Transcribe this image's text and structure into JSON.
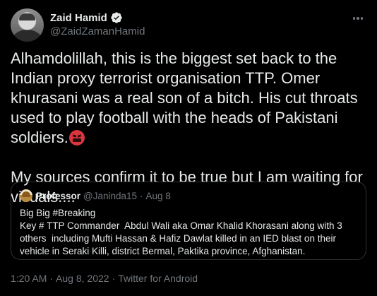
{
  "author": {
    "display_name": "Zaid Hamid",
    "handle": "@ZaidZamanHamid",
    "verified": true,
    "avatar_icon": "avatar-photo"
  },
  "tweet": {
    "line1": "Alhamdolillah, this is the biggest set back to the Indian proxy terrorist organisation TTP. Omer khurasani was a real son of a bitch. His cut throats used to play football with the heads of Pakistani soldiers.",
    "emoji": "enraged-face-with-symbols-on-mouth",
    "line2": "My sources confirm it to be true but I am waiting for visuals...."
  },
  "quote": {
    "name": "Professor",
    "handle": "@Janinda15",
    "dot": "·",
    "date": "Aug 8",
    "text": "Big Big #Breaking\nKey # TTP Commander  Abdul Wali aka Omar Khalid Khorasani along with 3 others  including Mufti Hassan & Hafiz Dawlat killed in an IED blast on their vehicle in Seraki Killi, district Bermal, Paktika province, Afghanistan."
  },
  "meta": {
    "time": "1:20 AM",
    "sep1": "·",
    "date": "Aug 8, 2022",
    "sep2": "·",
    "source": "Twitter for Android"
  },
  "colors": {
    "background": "#000000",
    "text": "#e7e9ea",
    "muted": "#71767b",
    "border": "#2f3336",
    "verified": "#1d9bf0"
  }
}
